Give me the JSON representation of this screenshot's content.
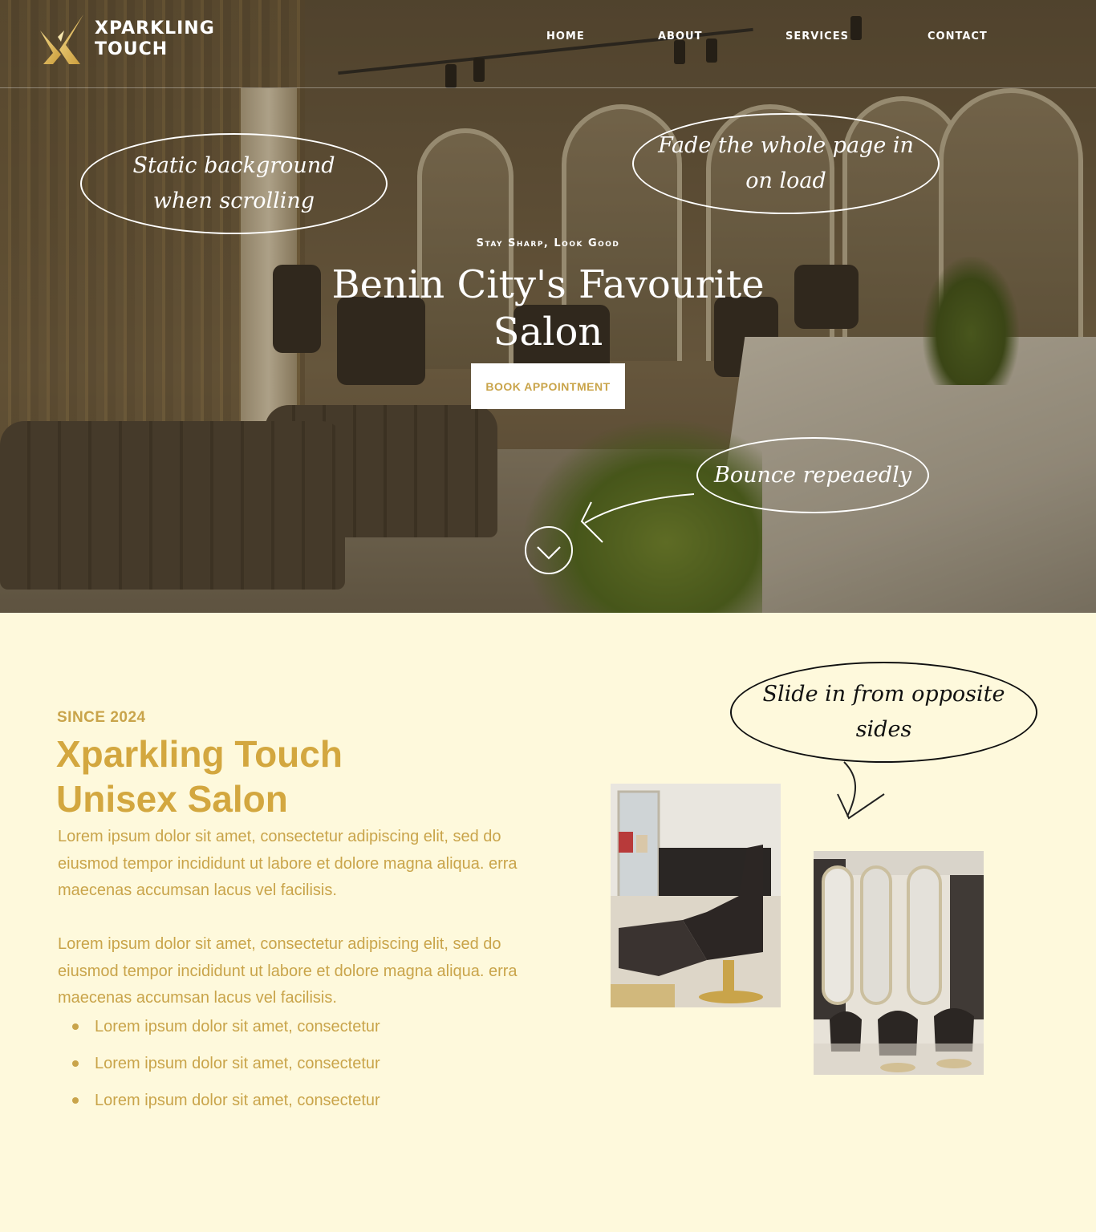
{
  "brand": {
    "line1": "XPARKLING",
    "line2": "TOUCH"
  },
  "nav": {
    "items": [
      "HOME",
      "ABOUT",
      "SERVICES",
      "CONTACT"
    ]
  },
  "hero": {
    "tagline": "Stay Sharp, Look Good",
    "title": "Benin City's Favourite Salon",
    "cta": "BOOK APPOINTMENT"
  },
  "annotations": {
    "static_bg": [
      "Static background",
      "when scrolling"
    ],
    "fade": [
      "Fade the whole page in",
      "on load"
    ],
    "bounce": [
      "Bounce repeaedly"
    ],
    "slide": [
      "Slide in from opposite",
      "sides"
    ]
  },
  "about": {
    "since": "SINCE 2024",
    "title_line1": "Xparkling Touch",
    "title_line2": "Unisex Salon",
    "paragraphs": [
      "Lorem ipsum dolor sit amet, consectetur adipiscing elit, sed do eiusmod tempor incididunt ut labore et dolore magna aliqua. erra maecenas accumsan lacus vel facilisis.",
      "Lorem ipsum dolor sit amet, consectetur adipiscing elit, sed do eiusmod tempor incididunt ut labore et dolore magna aliqua. erra maecenas accumsan lacus vel facilisis."
    ],
    "bullets": [
      "Lorem ipsum dolor sit amet, consectetur",
      "Lorem ipsum dolor sit amet, consectetur",
      "Lorem ipsum dolor sit amet, consectetur"
    ]
  },
  "colors": {
    "gold": "#c9a44a",
    "cream": "#fef9dc",
    "white": "#ffffff"
  },
  "icons": {
    "logo": "x-sparkle-logo",
    "scroll": "chevron-down-icon",
    "arrow": "curved-arrow-icon"
  }
}
